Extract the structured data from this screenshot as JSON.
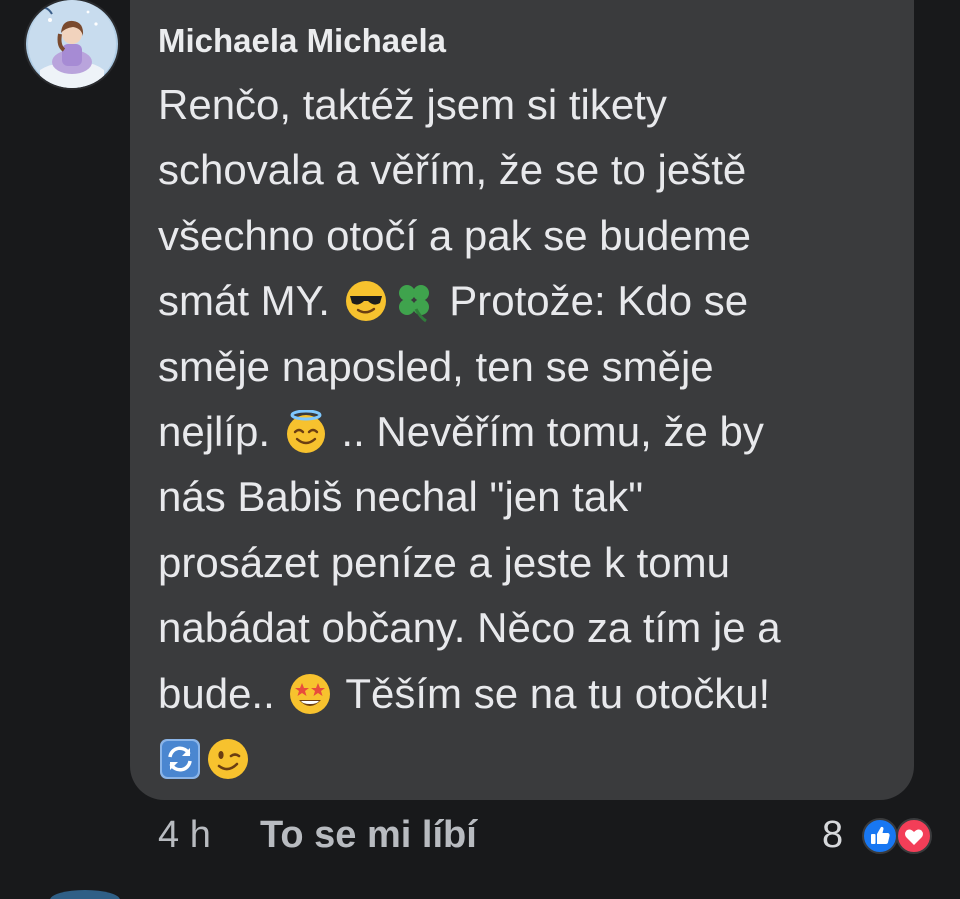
{
  "comment": {
    "author": "Michaela Michaela",
    "lines": [
      [
        "Renčo, taktéž jsem si tikety"
      ],
      [
        "schovala a věřím, že se to ještě"
      ],
      [
        "všechno otočí a pak se budeme"
      ],
      [
        "smát MY. ",
        "",
        "",
        " Protože: Kdo se"
      ],
      [
        "směje naposled, ten se směje"
      ],
      [
        "nejlíp. ",
        "",
        " .. Nevěřím tomu, že by"
      ],
      [
        "nás Babiš nechal \"jen tak\""
      ],
      [
        "prosázet peníze a jeste k tomu"
      ],
      [
        "nabádat občany. Něco za tím je a"
      ],
      [
        "bude.. ",
        "",
        "  Těším se na tu otočku!"
      ],
      [
        "",
        "",
        ""
      ]
    ],
    "emoji": {
      "sunglasses": "smiling-face-with-sunglasses",
      "clover": "four-leaf-clover",
      "halo": "smiling-face-with-halo",
      "starstruck": "star-struck",
      "repeat": "counterclockwise-arrows",
      "wink": "winking-face"
    }
  },
  "footer": {
    "time": "4 h",
    "like_label": "To se mi líbí",
    "reaction_count": "8"
  },
  "colors": {
    "background": "#18191b",
    "bubble": "#3a3b3d",
    "text": "#e8e9ec",
    "muted": "#b8bbc0",
    "like_blue": "#1877f2",
    "love_red": "#f33e58"
  }
}
